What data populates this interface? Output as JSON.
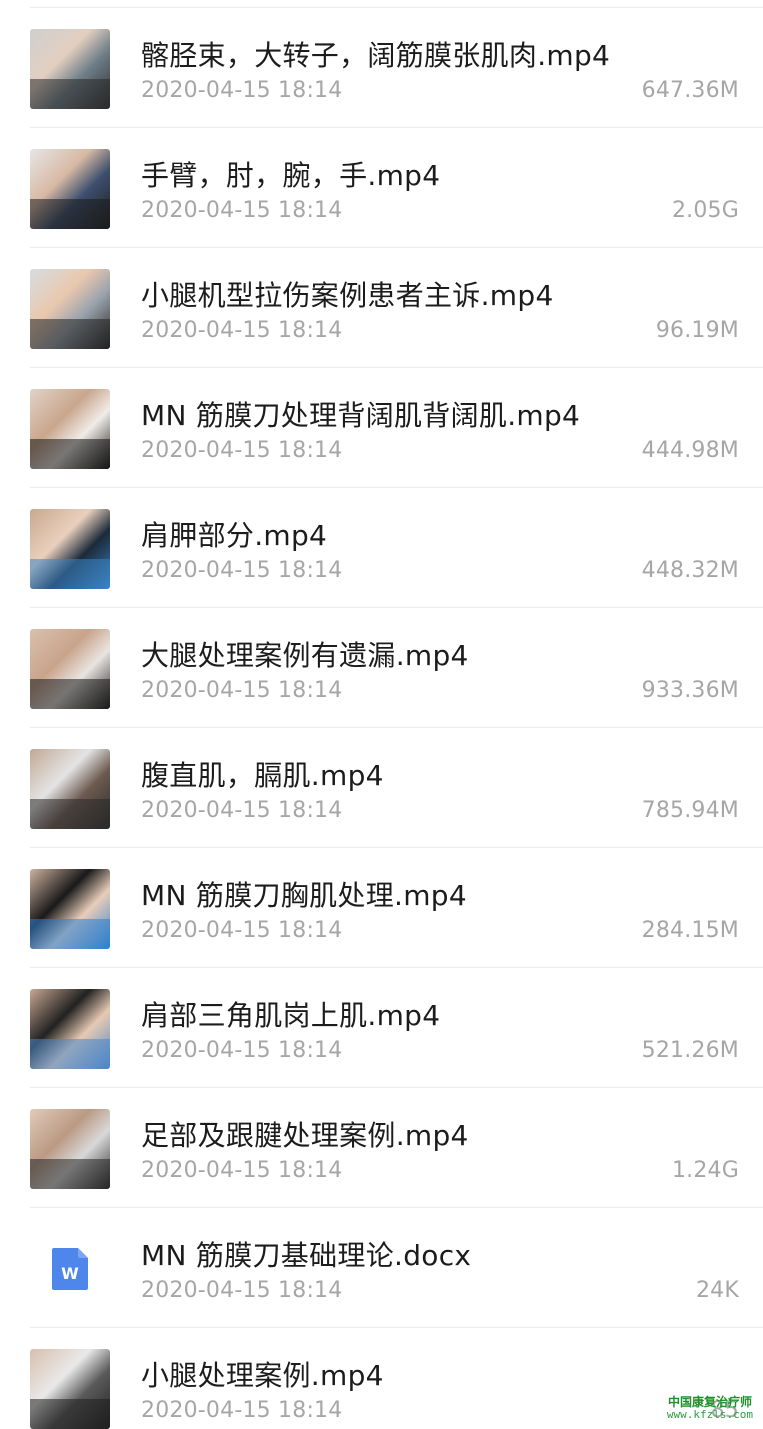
{
  "files": [
    {
      "name": "髂胫束，大转子，阔筋膜张肌肉.mp4",
      "date": "2020-04-15 18:14",
      "size": "647.36M",
      "type": "video",
      "thumb": "video-thumbnail-icon",
      "colors": [
        "#cfcfcf",
        "#2a2a2a",
        "#e3cfc0",
        "#6e7e88"
      ]
    },
    {
      "name": "手臂，肘，腕，手.mp4",
      "date": "2020-04-15 18:14",
      "size": "2.05G",
      "type": "video",
      "thumb": "video-thumbnail-icon",
      "colors": [
        "#e6e6e6",
        "#1b1b1b",
        "#d8b9a3",
        "#3d4f6e"
      ]
    },
    {
      "name": "小腿机型拉伤案例患者主诉.mp4",
      "date": "2020-04-15 18:14",
      "size": "96.19M",
      "type": "video",
      "thumb": "video-thumbnail-icon",
      "colors": [
        "#d8dce0",
        "#222222",
        "#e9c8ae",
        "#9aa3ad"
      ]
    },
    {
      "name": "MN 筋膜刀处理背阔肌背阔肌.mp4",
      "date": "2020-04-15 18:14",
      "size": "444.98M",
      "type": "video",
      "thumb": "video-thumbnail-icon",
      "colors": [
        "#e1d3c7",
        "#151515",
        "#caa68d",
        "#f0ece8"
      ]
    },
    {
      "name": "肩胛部分.mp4",
      "date": "2020-04-15 18:14",
      "size": "448.32M",
      "type": "video",
      "thumb": "video-thumbnail-icon",
      "colors": [
        "#c8a890",
        "#3a83c5",
        "#e9d0bd",
        "#1c2a3a"
      ]
    },
    {
      "name": "大腿处理案例有遗漏.mp4",
      "date": "2020-04-15 18:14",
      "size": "933.36M",
      "type": "video",
      "thumb": "video-thumbnail-icon",
      "colors": [
        "#d9c0ae",
        "#1a1a1a",
        "#c9a48c",
        "#e8e4e0"
      ]
    },
    {
      "name": "腹直肌，膈肌.mp4",
      "date": "2020-04-15 18:14",
      "size": "785.94M",
      "type": "video",
      "thumb": "video-thumbnail-icon",
      "colors": [
        "#c2a895",
        "#2a2a2a",
        "#e4e4e4",
        "#6d5a50"
      ]
    },
    {
      "name": "MN 筋膜刀胸肌处理.mp4",
      "date": "2020-04-15 18:14",
      "size": "284.15M",
      "type": "video",
      "thumb": "video-thumbnail-icon",
      "colors": [
        "#cfb2a0",
        "#2f7fcf",
        "#1a1a1a",
        "#e8cdb9"
      ]
    },
    {
      "name": "肩部三角肌岗上肌.mp4",
      "date": "2020-04-15 18:14",
      "size": "521.26M",
      "type": "video",
      "thumb": "video-thumbnail-icon",
      "colors": [
        "#c9a792",
        "#4a86c8",
        "#222222",
        "#e6c9b3"
      ]
    },
    {
      "name": "足部及跟腱处理案例.mp4",
      "date": "2020-04-15 18:14",
      "size": "1.24G",
      "type": "video",
      "thumb": "video-thumbnail-icon",
      "colors": [
        "#e0cbb9",
        "#262626",
        "#bb9a84",
        "#d8d8d8"
      ]
    },
    {
      "name": "MN 筋膜刀基础理论.docx",
      "date": "2020-04-15 18:14",
      "size": "24K",
      "type": "doc",
      "thumb": "word-document-icon",
      "colors": [
        "#4f86ec",
        "#7aa6f3",
        "#ffffff",
        "#ffffff"
      ],
      "doc_letter": "W"
    },
    {
      "name": "小腿处理案例.mp4",
      "date": "2020-04-15 18:14",
      "size": "85",
      "type": "video",
      "thumb": "video-thumbnail-icon",
      "colors": [
        "#d7bfae",
        "#1f1f1f",
        "#e9e9e9",
        "#5a5a5a"
      ]
    }
  ],
  "watermark": {
    "line1": "中国康复治疗师",
    "line2": "www.kfzls.com",
    "color": "#1f8f2a"
  }
}
